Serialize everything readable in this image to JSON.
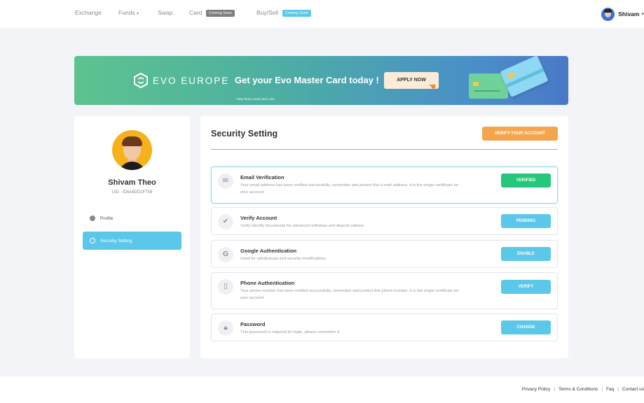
{
  "nav": {
    "items": [
      {
        "label": "Exchange"
      },
      {
        "label": "Funds",
        "caret": "▾"
      },
      {
        "label": "Swap"
      },
      {
        "label": "Card",
        "badge": "Coming Soon"
      },
      {
        "label": "Buy/Sell",
        "badge": "Coming Soon"
      }
    ],
    "user_name": "Shivam",
    "caret": "▾"
  },
  "banner": {
    "brand": "EVO EUROPE",
    "title": "Get your Evo Master Card today !",
    "cta": "APPLY NOW",
    "note": "*Max three cards each user"
  },
  "sidebar": {
    "name": "Shivam Theo",
    "uid": "UID : ID6A8DD1F759",
    "items": [
      {
        "label": "Profile"
      },
      {
        "label": "Security Setting"
      }
    ]
  },
  "main": {
    "title": "Security Setting",
    "verify_button": "VERIFY YOUR ACCOUNT",
    "rows": [
      {
        "title": "Email Verification",
        "desc": "Your email address has been verified successfully, remember and protect this e-mail address, it is the single certificate for your account.",
        "button": "VERIFIED",
        "icon": "envelope-icon"
      },
      {
        "title": "Verify Account",
        "desc": "Verify identify documents for advanced withdraw and deposit options",
        "button": "PENDING",
        "icon": "check-badge-icon"
      },
      {
        "title": "Google Authentication",
        "desc": "Used for withdrawals and security modifications",
        "button": "ENABLE",
        "icon": "google-icon"
      },
      {
        "title": "Phone Authentication",
        "desc": "Your phone number has been verified successfully, remember and protect this phone number, it is the single certificate for your account.",
        "button": "VERIFY",
        "icon": "phone-icon"
      },
      {
        "title": "Password",
        "desc": "This password is required for login, please remember it.",
        "button": "CHANGE",
        "icon": "lock-icon"
      }
    ]
  },
  "footer": {
    "links": [
      "Privacy Policy",
      "Terms & Conditions",
      "Faq",
      "Contact us"
    ],
    "separator": "|"
  },
  "colors": {
    "accent": "#5bc8e9",
    "orange": "#f5a54e",
    "green": "#24c77b",
    "badge_gray": "#7d7d7d"
  }
}
